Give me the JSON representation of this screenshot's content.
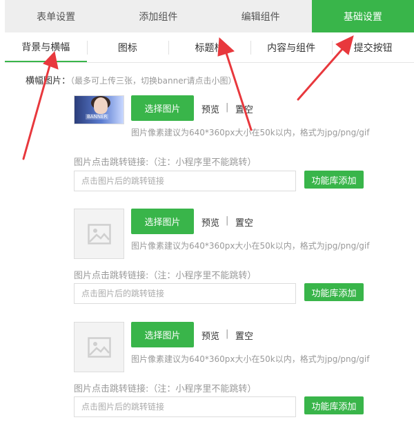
{
  "top_tabs": [
    {
      "label": "表单设置",
      "active": false
    },
    {
      "label": "添加组件",
      "active": false
    },
    {
      "label": "编辑组件",
      "active": false
    },
    {
      "label": "基础设置",
      "active": true
    }
  ],
  "sub_tabs": [
    {
      "label": "背景与横幅",
      "active": true
    },
    {
      "label": "图标",
      "active": false
    },
    {
      "label": "标题栏",
      "active": false
    },
    {
      "label": "内容与组件",
      "active": false
    },
    {
      "label": "提交按钮",
      "active": false
    }
  ],
  "banner_section": {
    "label": "横幅图片：",
    "hint": "（最多可上传三张，切换banner请点击小图）"
  },
  "banner_caption": "BANNER",
  "items": [
    {
      "has_image": true,
      "select_label": "选择图片",
      "preview_label": "预览",
      "separator": "|",
      "clear_label": "置空",
      "size_hint": "图片像素建议为640*360px大小在50k以内，格式为jpg/png/gif",
      "jump_label": "图片点击跳转链接:（注：小程序里不能跳转）",
      "jump_placeholder": "点击图片后的跳转链接",
      "jump_value": "",
      "lib_label": "功能库添加"
    },
    {
      "has_image": false,
      "select_label": "选择图片",
      "preview_label": "预览",
      "separator": "|",
      "clear_label": "置空",
      "size_hint": "图片像素建议为640*360px大小在50k以内，格式为jpg/png/gif",
      "jump_label": "图片点击跳转链接:（注：小程序里不能跳转）",
      "jump_placeholder": "点击图片后的跳转链接",
      "jump_value": "",
      "lib_label": "功能库添加"
    },
    {
      "has_image": false,
      "select_label": "选择图片",
      "preview_label": "预览",
      "separator": "|",
      "clear_label": "置空",
      "size_hint": "图片像素建议为640*360px大小在50k以内，格式为jpg/png/gif",
      "jump_label": "图片点击跳转链接:（注：小程序里不能跳转）",
      "jump_placeholder": "点击图片后的跳转链接",
      "jump_value": "",
      "lib_label": "功能库添加"
    }
  ],
  "colors": {
    "accent": "#39b54a",
    "annotation_arrow": "#e8383d",
    "tab_bar_bg": "#eeeeee"
  },
  "icons": {
    "placeholder": "image-placeholder-icon"
  }
}
